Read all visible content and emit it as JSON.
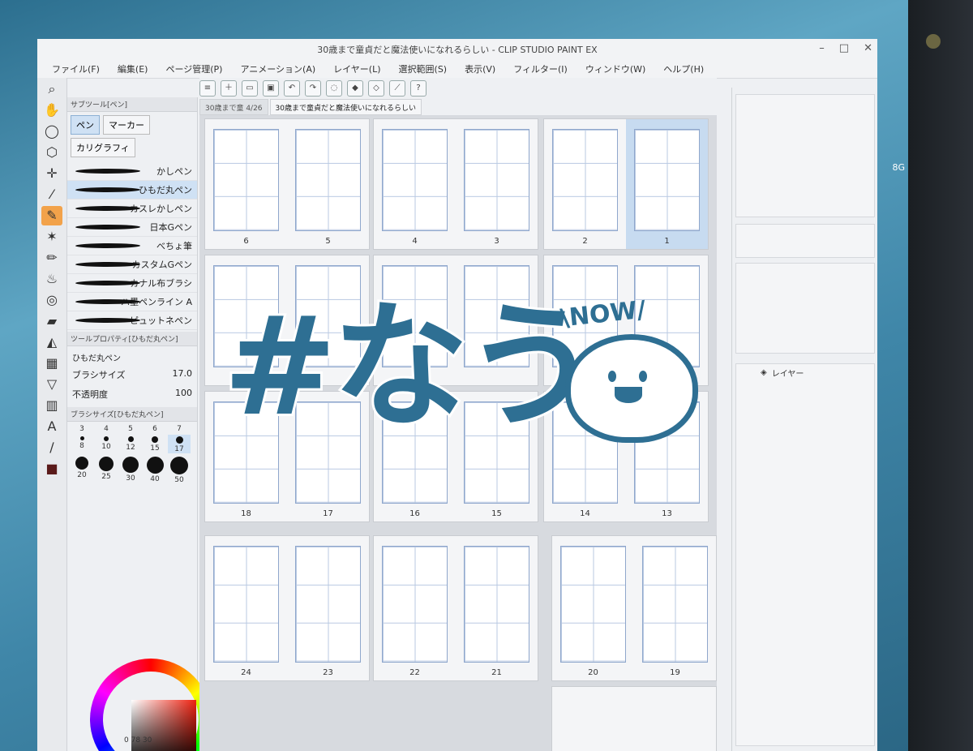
{
  "window": {
    "title": "30歳まで童貞だと魔法使いになれるらしい - CLIP STUDIO PAINT EX"
  },
  "menu": [
    "ファイル(F)",
    "編集(E)",
    "ページ管理(P)",
    "アニメーション(A)",
    "レイヤー(L)",
    "選択範囲(S)",
    "表示(V)",
    "フィルター(I)",
    "ウィンドウ(W)",
    "ヘルプ(H)"
  ],
  "side_label": "8G",
  "doc_tabs": [
    "30歳まで童 4/26",
    "30歳まで童貞だと魔法使いになれるらしい"
  ],
  "subtool": {
    "title": "サブツール[ペン]",
    "tabs": [
      "ペン",
      "マーカー",
      "カリグラフィ"
    ],
    "brushes": [
      "かしペン",
      "ひもだ丸ペン",
      "カスレかしペン",
      "日本Gペン",
      "べちょ筆",
      "カスタムGペン",
      "カナル布ブラシ",
      "ハ墨ペンライン A",
      "ピュットネペン"
    ]
  },
  "props": {
    "title": "ツールプロパティ[ひもだ丸ペン]",
    "brush_name": "ひもだ丸ペン",
    "size_label": "ブラシサイズ",
    "size_value": "17.0",
    "opacity_label": "不透明度",
    "opacity_value": "100"
  },
  "sizes": {
    "title": "ブラシサイズ[ひもだ丸ペン]",
    "values": [
      "3",
      "4",
      "5",
      "6",
      "7",
      "8",
      "10",
      "12",
      "15",
      "17",
      "20",
      "25",
      "30",
      "40",
      "50"
    ]
  },
  "color_footer": "0  78  30",
  "pages": [
    [
      "6",
      "5"
    ],
    [
      "4",
      "3"
    ],
    [
      "2",
      "1"
    ],
    [
      "",
      ""
    ],
    [
      "",
      ""
    ],
    [
      "",
      ""
    ],
    [
      "18",
      "17"
    ],
    [
      "16",
      "15"
    ],
    [
      "14",
      "13"
    ],
    [
      "24",
      "23"
    ],
    [
      "22",
      "21"
    ],
    [
      "20",
      "19"
    ]
  ],
  "layer_panel": {
    "tab": "レイヤー"
  },
  "overlay": {
    "text": "#なう",
    "now": "\\NOW/"
  }
}
